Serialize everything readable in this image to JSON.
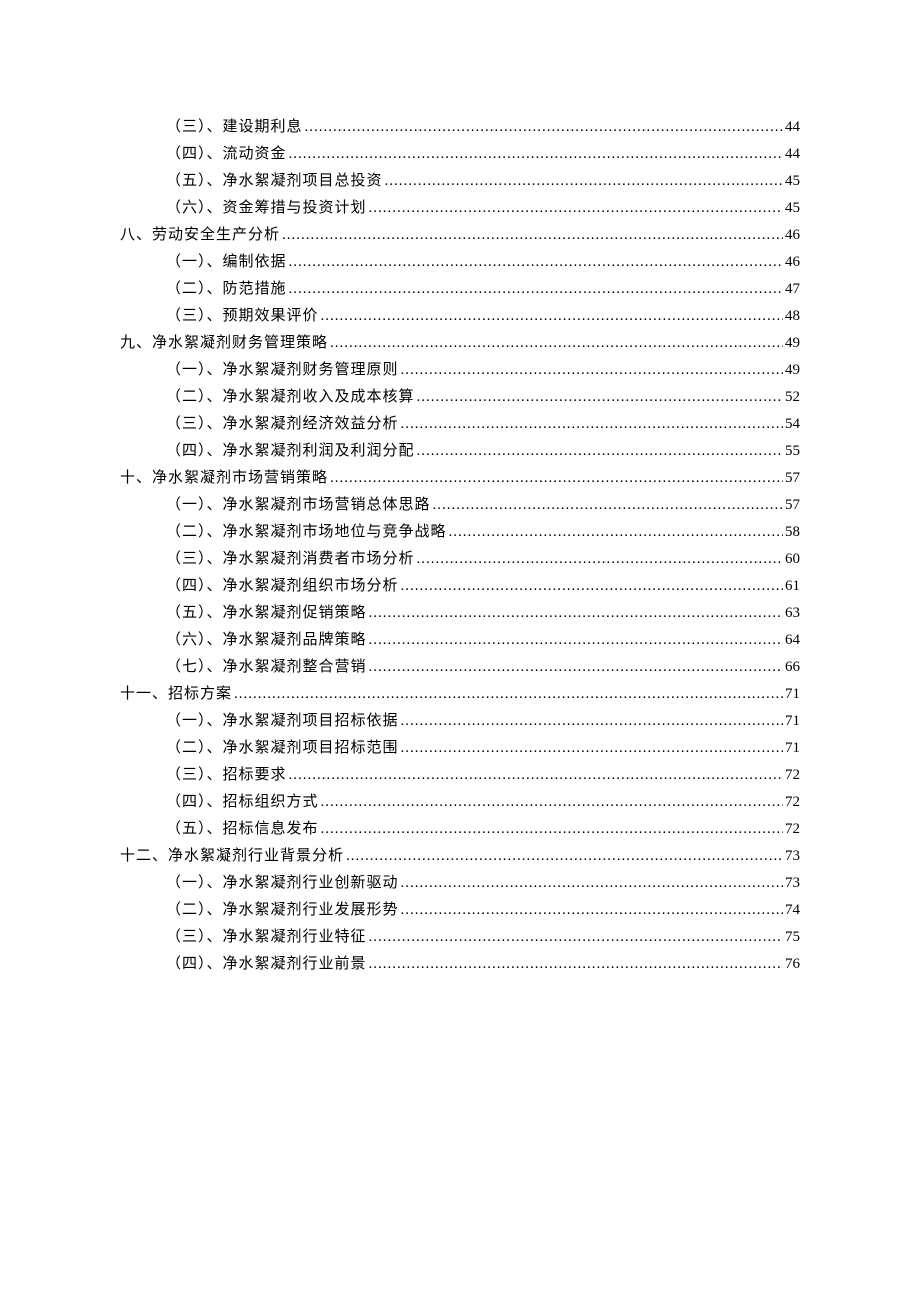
{
  "toc": [
    {
      "level": 2,
      "label": "（三）、建设期利息",
      "page": "44"
    },
    {
      "level": 2,
      "label": "（四）、流动资金",
      "page": "44"
    },
    {
      "level": 2,
      "label": "（五）、净水絮凝剂项目总投资",
      "page": "45"
    },
    {
      "level": 2,
      "label": "（六）、资金筹措与投资计划",
      "page": "45"
    },
    {
      "level": 1,
      "label": "八、劳动安全生产分析",
      "page": "46"
    },
    {
      "level": 2,
      "label": "（一）、编制依据",
      "page": "46"
    },
    {
      "level": 2,
      "label": "（二）、防范措施",
      "page": "47"
    },
    {
      "level": 2,
      "label": "（三）、预期效果评价",
      "page": "48"
    },
    {
      "level": 1,
      "label": "九、净水絮凝剂财务管理策略",
      "page": "49"
    },
    {
      "level": 2,
      "label": "（一）、净水絮凝剂财务管理原则",
      "page": "49"
    },
    {
      "level": 2,
      "label": "（二）、净水絮凝剂收入及成本核算",
      "page": "52"
    },
    {
      "level": 2,
      "label": "（三）、净水絮凝剂经济效益分析",
      "page": "54"
    },
    {
      "level": 2,
      "label": "（四）、净水絮凝剂利润及利润分配",
      "page": "55"
    },
    {
      "level": 1,
      "label": "十、净水絮凝剂市场营销策略",
      "page": "57"
    },
    {
      "level": 2,
      "label": "（一）、净水絮凝剂市场营销总体思路",
      "page": "57"
    },
    {
      "level": 2,
      "label": "（二）、净水絮凝剂市场地位与竞争战略",
      "page": "58"
    },
    {
      "level": 2,
      "label": "（三）、净水絮凝剂消费者市场分析",
      "page": "60"
    },
    {
      "level": 2,
      "label": "（四）、净水絮凝剂组织市场分析",
      "page": "61"
    },
    {
      "level": 2,
      "label": "（五）、净水絮凝剂促销策略",
      "page": "63"
    },
    {
      "level": 2,
      "label": "（六）、净水絮凝剂品牌策略",
      "page": "64"
    },
    {
      "level": 2,
      "label": "（七）、净水絮凝剂整合营销",
      "page": "66"
    },
    {
      "level": 1,
      "label": "十一、招标方案",
      "page": "71"
    },
    {
      "level": 2,
      "label": "（一）、净水絮凝剂项目招标依据",
      "page": "71"
    },
    {
      "level": 2,
      "label": "（二）、净水絮凝剂项目招标范围",
      "page": "71"
    },
    {
      "level": 2,
      "label": "（三）、招标要求",
      "page": "72"
    },
    {
      "level": 2,
      "label": "（四）、招标组织方式",
      "page": "72"
    },
    {
      "level": 2,
      "label": "（五）、招标信息发布",
      "page": "72"
    },
    {
      "level": 1,
      "label": "十二、净水絮凝剂行业背景分析",
      "page": "73"
    },
    {
      "level": 2,
      "label": "（一）、净水絮凝剂行业创新驱动",
      "page": "73"
    },
    {
      "level": 2,
      "label": "（二）、净水絮凝剂行业发展形势",
      "page": "74"
    },
    {
      "level": 2,
      "label": "（三）、净水絮凝剂行业特征",
      "page": "75"
    },
    {
      "level": 2,
      "label": "（四）、净水絮凝剂行业前景",
      "page": "76"
    }
  ]
}
